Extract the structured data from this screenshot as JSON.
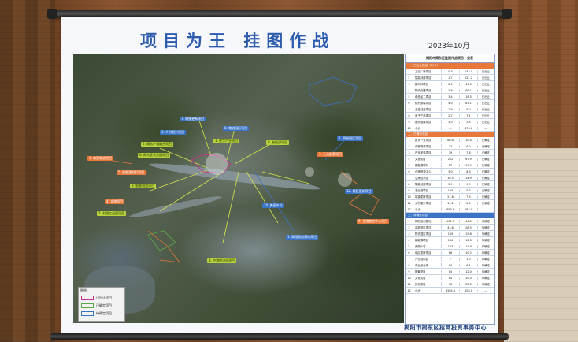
{
  "poster": {
    "title": "项目为王   挂图作战",
    "date": "2023年10月",
    "footer": "揭阳市揭东区招商投资事务中心"
  },
  "legend": {
    "heading": "图例",
    "items": [
      {
        "label": "已出让项目",
        "color": "#c8328c"
      },
      {
        "label": "已确定项目",
        "color": "#5aa84a"
      },
      {
        "label": "待确定项目",
        "color": "#3b74c7"
      }
    ]
  },
  "map_labels": [
    {
      "text": "7. 城镇更新项目",
      "cls": "b"
    },
    {
      "text": "3. 乡村振兴项目",
      "cls": "b"
    },
    {
      "text": "5. 揭东产城融合项目",
      "cls": "y"
    },
    {
      "text": "6. 揭东区农业园项目",
      "cls": "y"
    },
    {
      "text": "8. 物流园区项目",
      "cls": "b"
    },
    {
      "text": "9. 新能源项目",
      "cls": "y"
    },
    {
      "text": "1. 数字产业项目",
      "cls": "y"
    },
    {
      "text": "1. 商贸物流项目",
      "cls": "o"
    },
    {
      "text": "5. 新能源材料项目",
      "cls": "o"
    },
    {
      "text": "9. 智能制造项目",
      "cls": "y"
    },
    {
      "text": "2. 高新园区项目",
      "cls": "b"
    },
    {
      "text": "4. 文旅项目",
      "cls": "o"
    },
    {
      "text": "3. 石化配套项目",
      "cls": "o"
    },
    {
      "text": "7. 村级工业园项目",
      "cls": "y"
    },
    {
      "text": "10. 美丽乡村",
      "cls": "b"
    },
    {
      "text": "8. 空港经济区项目",
      "cls": "y"
    },
    {
      "text": "1. 揭阳双创基地项目",
      "cls": "b"
    },
    {
      "text": "6. 仓储物流中心项目",
      "cls": "o"
    },
    {
      "text": "12. 城区更新项目",
      "cls": "b"
    }
  ],
  "table": {
    "heading": "揭阳市揭东区挂图作战项目一览表",
    "section1": "一、已出让项目（11个）",
    "rows1": [
      [
        "1",
        "工业厂房项目",
        "0.5",
        "133.0",
        "已出让"
      ],
      [
        "2",
        "智能制造项目",
        "1.7",
        "131.2",
        "已出让"
      ],
      [
        "3",
        "新材料项目",
        "2.1",
        "41.5",
        "已出让"
      ],
      [
        "4",
        "物流仓储项目",
        "2.6",
        "69.1",
        "已出让"
      ],
      [
        "5",
        "食品加工项目",
        "3.4",
        "18.5",
        "已出让"
      ],
      [
        "6",
        "纺织服装项目",
        "4.0",
        "63.1",
        "已出让"
      ],
      [
        "7",
        "五金制品项目",
        "1.9",
        "5.0",
        "已出让"
      ],
      [
        "8",
        "电子产品项目",
        "2.7",
        "7.1",
        "已出让"
      ],
      [
        "9",
        "医药健康项目",
        "3.3",
        "2.4",
        "已出让"
      ],
      [
        "10",
        "小计",
        "—",
        "470.0",
        "—"
      ]
    ],
    "section2": "二、已确定项目",
    "rows2": [
      [
        "1",
        "数字产业项目",
        "88.8",
        "10.4",
        "已确定"
      ],
      [
        "2",
        "商贸物流项目",
        "37",
        "6.0",
        "已确定"
      ],
      [
        "3",
        "石化配套项目",
        "19",
        "7.6",
        "已确定"
      ],
      [
        "4",
        "文旅项目",
        "262",
        "67.9",
        "已确定"
      ],
      [
        "5",
        "新能源材料",
        "27",
        "19.9",
        "已确定"
      ],
      [
        "6",
        "仓储物流中心",
        "3.0",
        "8.3",
        "已确定"
      ],
      [
        "7",
        "空港经济区",
        "36.4",
        "24.9",
        "已确定"
      ],
      [
        "8",
        "智能制造项目",
        "3.9",
        "9.9",
        "已确定"
      ],
      [
        "9",
        "农业园项目",
        "125",
        "5.5",
        "已确定"
      ],
      [
        "10",
        "城镇更新项目",
        "21.6",
        "7.5",
        "已确定"
      ],
      [
        "11",
        "乡村振兴项目",
        "19.2",
        "2.0",
        "已确定"
      ],
      [
        "12",
        "小计",
        "893.6",
        "183.0",
        "—"
      ]
    ],
    "section3": "三、待确定项目",
    "rows3": [
      [
        "1",
        "揭阳双创基地",
        "132.5",
        "44.2",
        "待确定"
      ],
      [
        "2",
        "高新园区项目",
        "43.6",
        "28.5",
        "待确定"
      ],
      [
        "3",
        "物流园区项目",
        "169",
        "19.8",
        "待确定"
      ],
      [
        "4",
        "新能源项目",
        "106",
        "12.3",
        "待确定"
      ],
      [
        "5",
        "美丽乡村",
        "103",
        "11.9",
        "待确定"
      ],
      [
        "6",
        "城区更新项目",
        "88",
        "10.2",
        "待确定"
      ],
      [
        "7",
        "产业园项目",
        "7",
        "1.0",
        "待确定"
      ],
      [
        "8",
        "商业综合体",
        "84",
        "8.4",
        "待确定"
      ],
      [
        "9",
        "配套项目",
        "84",
        "12.0",
        "待确定"
      ],
      [
        "10",
        "文化项目",
        "84",
        "20.0",
        "待确定"
      ],
      [
        "11",
        "其他项目",
        "98",
        "22.0",
        "待确定"
      ],
      [
        "12",
        "小计",
        "1585.4",
        "428.9",
        "—"
      ]
    ]
  }
}
